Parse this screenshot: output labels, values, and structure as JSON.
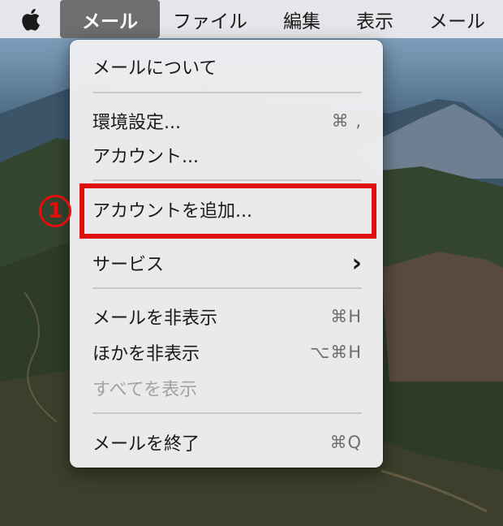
{
  "menubar": {
    "items": [
      "メール",
      "ファイル",
      "編集",
      "表示",
      "メール"
    ]
  },
  "menu": {
    "about": "メールについて",
    "preferences": {
      "label": "環境設定...",
      "shortcut": "⌘ ,"
    },
    "accounts": "アカウント...",
    "add_account": "アカウントを追加...",
    "services": {
      "label": "サービス",
      "chevron": "›"
    },
    "hide_mail": {
      "label": "メールを非表示",
      "shortcut": "⌘H"
    },
    "hide_others": {
      "label": "ほかを非表示",
      "shortcut": "⌥⌘H"
    },
    "show_all": "すべてを表示",
    "quit": {
      "label": "メールを終了",
      "shortcut": "⌘Q"
    }
  },
  "annotation": {
    "step": "1"
  },
  "colors": {
    "highlight": "#e10e0e",
    "active_menu_bg": "#6e6e70"
  }
}
